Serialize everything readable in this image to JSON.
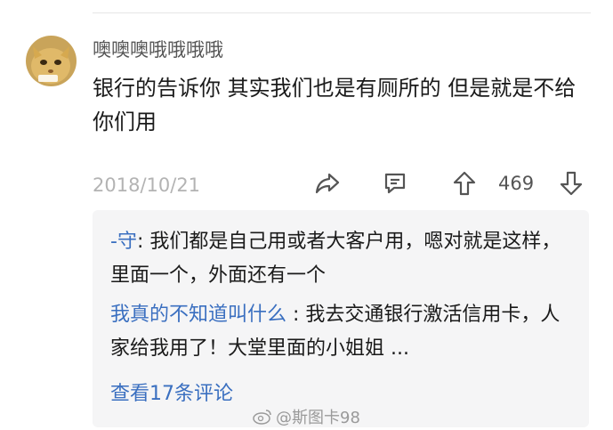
{
  "comment": {
    "username": "噢噢噢哦哦哦哦",
    "text": "银行的告诉你 其实我们也是有厕所的 但是就是不给你们用",
    "date": "2018/10/21",
    "like_count": "469",
    "icons": [
      "share-icon",
      "reply-icon",
      "upvote-icon",
      "downvote-icon"
    ]
  },
  "replies": [
    {
      "author": "-守",
      "separator": ": ",
      "text": "我们都是自己用或者大客户用，嗯对就是这样，里面一个，外面还有一个"
    },
    {
      "author": "我真的不知道叫什么",
      "separator": " : ",
      "text": "我去交通银行激活信用卡，人家给我用了！大堂里面的小姐姐 ..."
    }
  ],
  "view_more": "查看17条评论",
  "watermark": "@斯图卡98",
  "colors": {
    "link": "#3a6fc0",
    "reply_bg": "#f5f5f6",
    "muted": "#b3b3b3"
  }
}
